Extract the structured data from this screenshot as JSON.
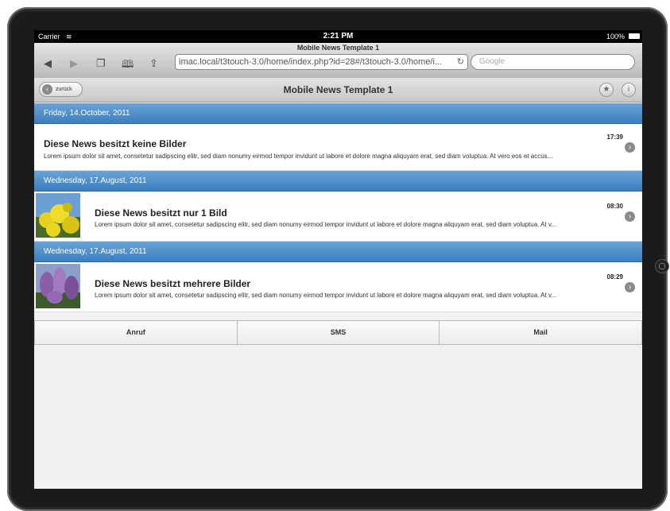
{
  "status": {
    "carrier": "Carrier",
    "time": "2:21 PM",
    "battery": "100%"
  },
  "browser": {
    "page_title": "Mobile News Template 1",
    "url": "imac.local/t3touch-3.0/home/index.php?id=28#/t3touch-3.0/home/i...",
    "search_placeholder": "Google"
  },
  "appbar": {
    "back_label": "zurück",
    "title": "Mobile News Template 1"
  },
  "sections": [
    {
      "date": "Friday, 14.October, 2011",
      "item": {
        "title": "Diese News besitzt keine Bilder",
        "time": "17:39",
        "desc": "Lorem ipsum dolor sit amet, consetetur sadipscing elitr, sed diam nonumy eirmod tempor invidunt ut labore et dolore magna aliquyam erat, sed diam voluptua. At vero eos et accus..."
      }
    },
    {
      "date": "Wednesday, 17.August, 2011",
      "item": {
        "title": "Diese News besitzt nur 1 Bild",
        "time": "08:30",
        "desc": "Lorem ipsum dolor sit amet, consetetur sadipscing elitr, sed diam nonumy eirmod tempor invidunt ut labore et dolore magna aliquyam erat, sed diam voluptua. At v..."
      }
    },
    {
      "date": "Wednesday, 17.August, 2011",
      "item": {
        "title": "Diese News besitzt mehrere Bilder",
        "time": "08:29",
        "desc": "Lorem ipsum dolor sit amet, consetetur sadipscing elitr, sed diam nonumy eirmod tempor invidunt ut labore et dolore magna aliquyam erat, sed diam voluptua. At v..."
      }
    }
  ],
  "tabs": [
    "Anruf",
    "SMS",
    "Mail"
  ],
  "colors": {
    "header_blue": "#3b7fbf",
    "chevron_gray": "#8a8a8a"
  }
}
